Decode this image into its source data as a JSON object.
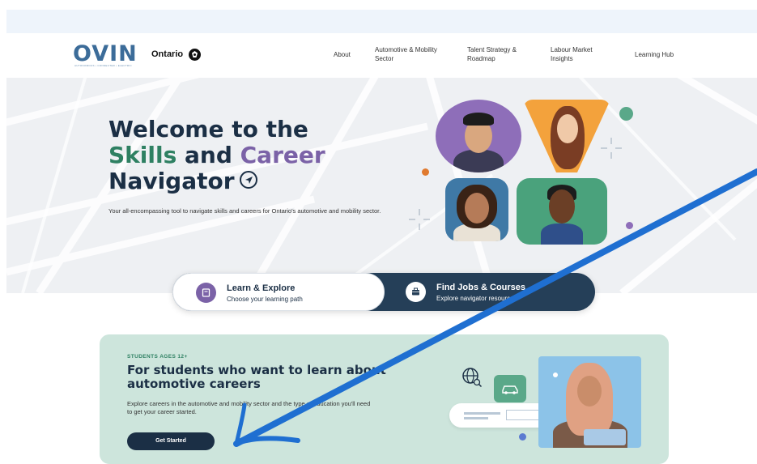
{
  "header": {
    "logo_text": "OVIN",
    "logo_subtitle": "AUTONOMOUS • CONNECTED • ELECTRIC",
    "ontario_label": "Ontario",
    "nav": [
      {
        "label": "About"
      },
      {
        "label": "Automotive & Mobility Sector"
      },
      {
        "label": "Talent Strategy & Roadmap"
      },
      {
        "label": "Labour Market Insights"
      },
      {
        "label": "Learning Hub"
      }
    ]
  },
  "hero": {
    "title_line1": "Welcome to the",
    "title_skills": "Skills",
    "title_and": "and",
    "title_career": "Career",
    "title_line3": "Navigator",
    "description": "Your all-encompassing tool to navigate skills and careers for Ontario's automotive and mobility sector."
  },
  "tabs": [
    {
      "title": "Learn & Explore",
      "subtitle": "Choose your learning path",
      "icon": "book-icon"
    },
    {
      "title": "Find Jobs & Courses",
      "subtitle": "Explore navigator resources",
      "icon": "briefcase-icon"
    }
  ],
  "students": {
    "eyebrow": "STUDENTS AGES 12+",
    "title": "For students who want to learn about automotive careers",
    "description": "Explore careers in the automotive and mobility sector and the type of education you'll need to get your career started.",
    "button": "Get Started"
  },
  "colors": {
    "navy": "#1b2f45",
    "green": "#2e8062",
    "purple": "#7b62a7",
    "card_bg": "#cde5dc",
    "annotation_blue": "#1f6fd1"
  }
}
